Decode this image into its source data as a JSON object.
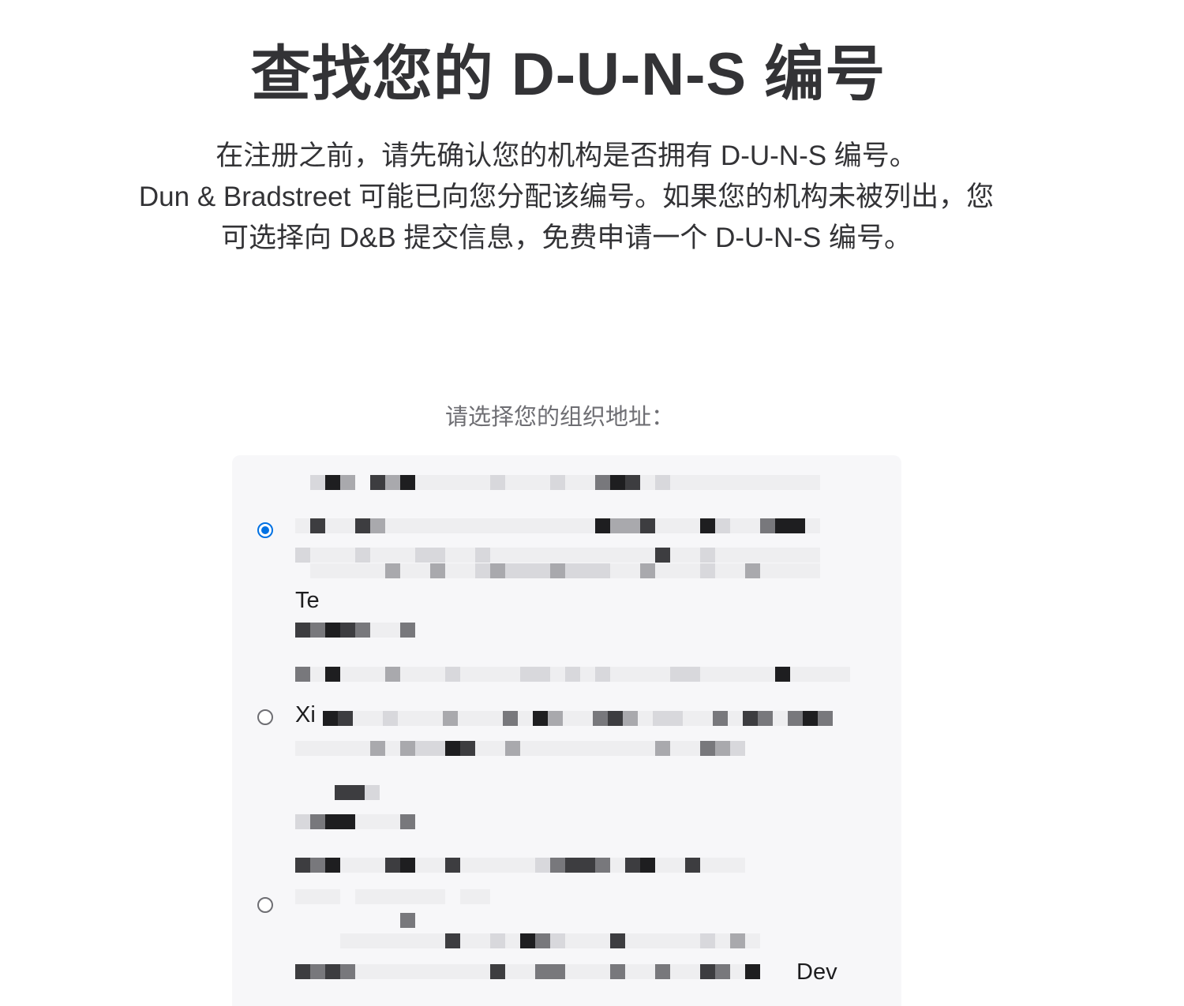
{
  "header": {
    "title": "查找您的 D-U-N-S 编号",
    "intro_line1": "在注册之前，请先确认您的机构是否拥有 D-U-N-S 编号。",
    "intro_line2": "Dun & Bradstreet 可能已向您分配该编号。如果您的机构未被列出，您",
    "intro_line3": "可选择向 D&B 提交信息，免费申请一个 D-U-N-S 编号。"
  },
  "address_selection": {
    "label": "请选择您的组织地址：",
    "options": [
      {
        "selected": true,
        "visible_fragment": "Te",
        "redacted": true
      },
      {
        "selected": false,
        "visible_fragment": "Xi",
        "redacted": true
      },
      {
        "selected": false,
        "visible_fragment": "Dev",
        "redacted": true
      }
    ]
  },
  "colors": {
    "accent": "#0071e3",
    "text_primary": "#333336",
    "text_secondary": "#6e6e73",
    "panel_background": "#f7f7f9"
  }
}
